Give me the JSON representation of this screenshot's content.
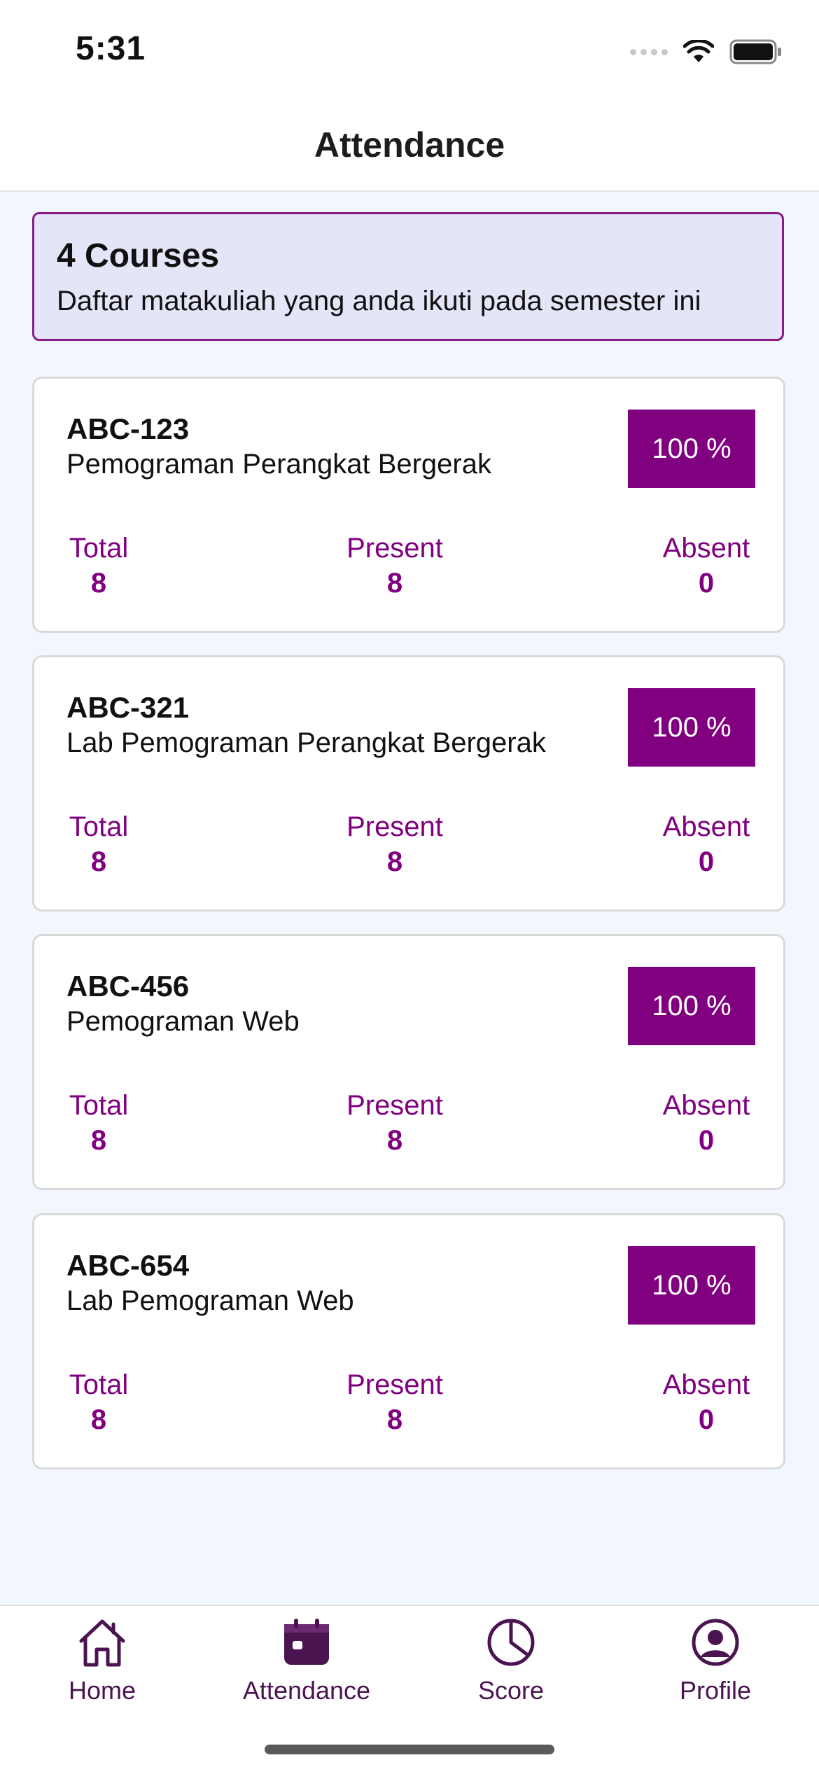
{
  "status_bar": {
    "time": "5:31"
  },
  "header": {
    "title": "Attendance"
  },
  "summary": {
    "title": "4 Courses",
    "subtitle": "Daftar matakuliah yang anda ikuti pada semester ini"
  },
  "labels": {
    "total": "Total",
    "present": "Present",
    "absent": "Absent"
  },
  "courses": [
    {
      "code": "ABC-123",
      "name": "Pemograman Perangkat Bergerak",
      "percent": "100 %",
      "total": "8",
      "present": "8",
      "absent": "0"
    },
    {
      "code": "ABC-321",
      "name": "Lab Pemograman Perangkat Bergerak",
      "percent": "100 %",
      "total": "8",
      "present": "8",
      "absent": "0"
    },
    {
      "code": "ABC-456",
      "name": "Pemograman Web",
      "percent": "100 %",
      "total": "8",
      "present": "8",
      "absent": "0"
    },
    {
      "code": "ABC-654",
      "name": "Lab Pemograman Web",
      "percent": "100 %",
      "total": "8",
      "present": "8",
      "absent": "0"
    }
  ],
  "tabs": [
    {
      "label": "Home",
      "icon": "home-icon"
    },
    {
      "label": "Attendance",
      "icon": "calendar-icon",
      "active": true
    },
    {
      "label": "Score",
      "icon": "pie-chart-icon"
    },
    {
      "label": "Profile",
      "icon": "profile-icon"
    }
  ],
  "colors": {
    "accent": "#800080",
    "summary_bg": "#e4e5f7",
    "page_bg": "#f1f7fc",
    "tab_icon": "#4a1450"
  }
}
